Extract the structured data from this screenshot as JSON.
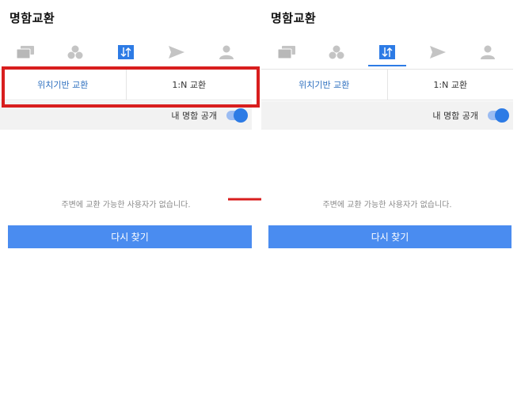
{
  "screens": [
    {
      "app_title": "명함교환",
      "tabs": [
        {
          "icon": "cards-icon",
          "active": false
        },
        {
          "icon": "group-icon",
          "active": false
        },
        {
          "icon": "exchange-icon",
          "active": true
        },
        {
          "icon": "send-icon",
          "active": false
        },
        {
          "icon": "person-icon",
          "active": false
        }
      ],
      "subtabs": [
        {
          "label": "위치기반 교환",
          "active": true
        },
        {
          "label": "1:N 교환",
          "active": false
        }
      ],
      "public_label": "내 명함 공개",
      "toggle_on": true,
      "empty_message": "주변에 교환 가능한 사용자가 없습니다.",
      "retry_label": "다시 찾기"
    },
    {
      "app_title": "명함교환",
      "tabs": [
        {
          "icon": "cards-icon",
          "active": false
        },
        {
          "icon": "group-icon",
          "active": false
        },
        {
          "icon": "exchange-icon",
          "active": true
        },
        {
          "icon": "send-icon",
          "active": false
        },
        {
          "icon": "person-icon",
          "active": false
        }
      ],
      "subtabs": [
        {
          "label": "위치기반 교환",
          "active": true
        },
        {
          "label": "1:N 교환",
          "active": false
        }
      ],
      "public_label": "내 명함 공개",
      "toggle_on": true,
      "empty_message": "주변에 교환 가능한 사용자가 없습니다.",
      "retry_label": "다시 찾기"
    }
  ],
  "colors": {
    "accent": "#2d7be5",
    "button": "#4a8cf0",
    "highlight": "#d81e1e",
    "icon_inactive": "#c4c4c4"
  }
}
